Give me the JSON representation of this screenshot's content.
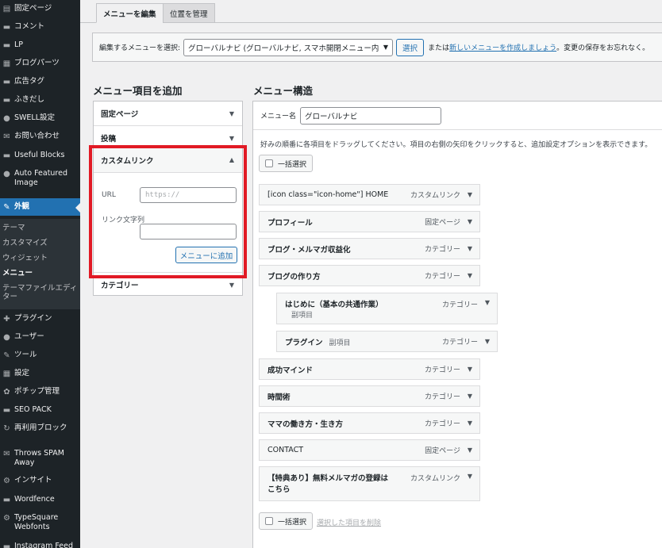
{
  "sidebar": {
    "items": [
      {
        "icon": "pages-icon",
        "glyph": "▤",
        "label": "固定ページ"
      },
      {
        "icon": "comments-icon",
        "glyph": "▬",
        "label": "コメント"
      },
      {
        "icon": "lp-icon",
        "glyph": "▬",
        "label": "LP"
      },
      {
        "icon": "blog-parts-icon",
        "glyph": "▦",
        "label": "ブログパーツ"
      },
      {
        "icon": "ad-tag-icon",
        "glyph": "▬",
        "label": "広告タグ"
      },
      {
        "icon": "balloon-icon",
        "glyph": "▬",
        "label": "ふきだし"
      },
      {
        "icon": "swell-settings-icon",
        "glyph": "●",
        "label": "SWELL設定"
      },
      {
        "icon": "contact-icon",
        "glyph": "✉",
        "label": "お問い合わせ"
      },
      {
        "icon": "blocks-icon",
        "glyph": "▬",
        "label": "Useful Blocks"
      },
      {
        "icon": "featured-image-icon",
        "glyph": "●",
        "label": "Auto Featured Image"
      },
      {
        "icon": "appearance-icon",
        "glyph": "✎",
        "label": "外観"
      },
      {
        "icon": "plugins-icon",
        "glyph": "✚",
        "label": "プラグイン"
      },
      {
        "icon": "users-icon",
        "glyph": "●",
        "label": "ユーザー"
      },
      {
        "icon": "tools-icon",
        "glyph": "✎",
        "label": "ツール"
      },
      {
        "icon": "settings-icon",
        "glyph": "▦",
        "label": "設定"
      },
      {
        "icon": "popup-icon",
        "glyph": "✿",
        "label": "ポチップ管理"
      },
      {
        "icon": "seo-icon",
        "glyph": "▬",
        "label": "SEO PACK"
      },
      {
        "icon": "reusable-blocks-icon",
        "glyph": "↻",
        "label": "再利用ブロック"
      },
      {
        "icon": "throws-spam-icon",
        "glyph": "✉",
        "label": "Throws SPAM Away"
      },
      {
        "icon": "insight-icon",
        "glyph": "⚙",
        "label": "インサイト"
      },
      {
        "icon": "wordfence-icon",
        "glyph": "▬",
        "label": "Wordfence"
      },
      {
        "icon": "typesquare-icon",
        "glyph": "⚙",
        "label": "TypeSquare Webfonts"
      },
      {
        "icon": "instagram-icon",
        "glyph": "▬",
        "label": "Instagram Feed"
      }
    ],
    "submenu": [
      "テーマ",
      "カスタマイズ",
      "ウィジェット",
      "メニュー",
      "テーマファイルエディター"
    ]
  },
  "tabs": {
    "edit": "メニューを編集",
    "locations": "位置を管理"
  },
  "select_bar": {
    "label": "編集するメニューを選択:",
    "selected": "グローバルナビ (グローバルナビ, スマホ開閉メニュー内)",
    "select_button": "選択",
    "or_text": "または",
    "new_link": "新しいメニューを作成しましょう",
    "suffix": "。変更の保存をお忘れなく。"
  },
  "add_items": {
    "heading": "メニュー項目を追加",
    "sections": {
      "pages": "固定ページ",
      "posts": "投稿",
      "custom": "カスタムリンク",
      "categories": "カテゴリー"
    },
    "url_label": "URL",
    "url_placeholder": "https://",
    "text_label": "リンク文字列",
    "add_button": "メニューに追加"
  },
  "structure": {
    "heading": "メニュー構造",
    "name_label": "メニュー名",
    "name_value": "グローバルナビ",
    "instructions": "好みの順番に各項目をドラッグしてください。項目の右側の矢印をクリックすると、追加設定オプションを表示できます。",
    "bulk_select": "一括選択",
    "delete_selected": "選択した項目を削除",
    "sub_label": "副項目",
    "items": [
      {
        "title": "[icon class=\"icon-home\"] HOME",
        "type": "カスタムリンク",
        "level": 0
      },
      {
        "title": "プロフィール",
        "type": "固定ページ",
        "level": 0
      },
      {
        "title": "ブログ・メルマガ収益化",
        "type": "カテゴリー",
        "level": 0
      },
      {
        "title": "ブログの作り方",
        "type": "カテゴリー",
        "level": 0
      },
      {
        "title": "はじめに（基本の共通作業）",
        "type": "カテゴリー",
        "level": 1
      },
      {
        "title": "プラグイン",
        "type": "カテゴリー",
        "level": 1
      },
      {
        "title": "成功マインド",
        "type": "カテゴリー",
        "level": 0
      },
      {
        "title": "時間術",
        "type": "カテゴリー",
        "level": 0
      },
      {
        "title": "ママの働き方・生き方",
        "type": "カテゴリー",
        "level": 0
      },
      {
        "title": "CONTACT",
        "type": "固定ページ",
        "level": 0
      },
      {
        "title": "【特典あり】無料メルマガの登録はこちら",
        "type": "カスタムリンク",
        "level": 0
      }
    ]
  }
}
